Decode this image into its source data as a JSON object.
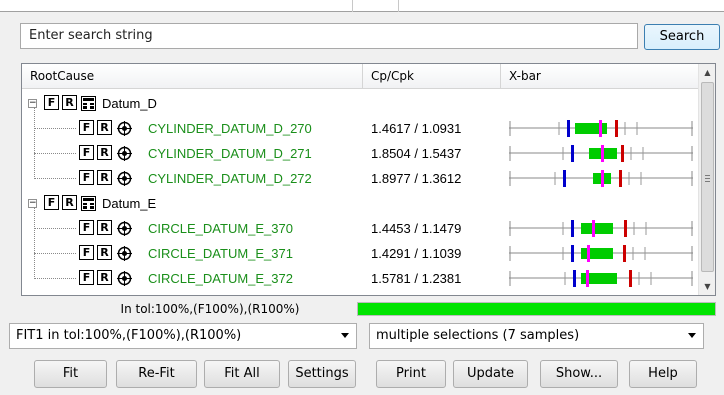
{
  "search": {
    "placeholder": "Enter search string",
    "button_label": "Search"
  },
  "tree": {
    "columns": [
      "RootCause",
      "Cp/Cpk",
      "X-bar"
    ],
    "rows": [
      {
        "kind": "group",
        "label": "Datum_D"
      },
      {
        "kind": "item",
        "label": "CYLINDER_DATUM_D_270",
        "cpk": "1.4617 / 1.0931"
      },
      {
        "kind": "item",
        "label": "CYLINDER_DATUM_D_271",
        "cpk": "1.8504 / 1.5437"
      },
      {
        "kind": "item",
        "label": "CYLINDER_DATUM_D_272",
        "cpk": "1.8977 / 1.3612"
      },
      {
        "kind": "group",
        "label": "Datum_E"
      },
      {
        "kind": "item",
        "label": "CIRCLE_DATUM_E_370",
        "cpk": "1.4453 / 1.1479"
      },
      {
        "kind": "item",
        "label": "CIRCLE_DATUM_E_371",
        "cpk": "1.4291 / 1.1039"
      },
      {
        "kind": "item",
        "label": "CIRCLE_DATUM_E_372",
        "cpk": "1.5781 / 1.2381"
      }
    ],
    "f_label": "F",
    "r_label": "R",
    "expander_symbol": "−"
  },
  "status": {
    "tolerance_text": "In tol:100%,(F100%),(R100%)",
    "progress_percent": 100
  },
  "dropdowns": {
    "fit": "FIT1 in tol:100%,(F100%),(R100%)",
    "samples": "multiple selections (7 samples)"
  },
  "buttons": {
    "fit": "Fit",
    "refit": "Re-Fit",
    "fit_all": "Fit All",
    "settings": "Settings",
    "print": "Print",
    "update": "Update",
    "show": "Show...",
    "help": "Help"
  },
  "colors": {
    "green_text": "#1a8f1a",
    "progress_fill": "#00e400",
    "accent_border": "#3c7fb1",
    "bar_blue": "#0000cc",
    "bar_green": "#00cc00",
    "bar_magenta": "#ff00ff",
    "bar_red": "#cc0000"
  },
  "icons": {
    "group": "grid-icon",
    "item": "measurement-icon",
    "expander": "collapse-minus-icon"
  }
}
